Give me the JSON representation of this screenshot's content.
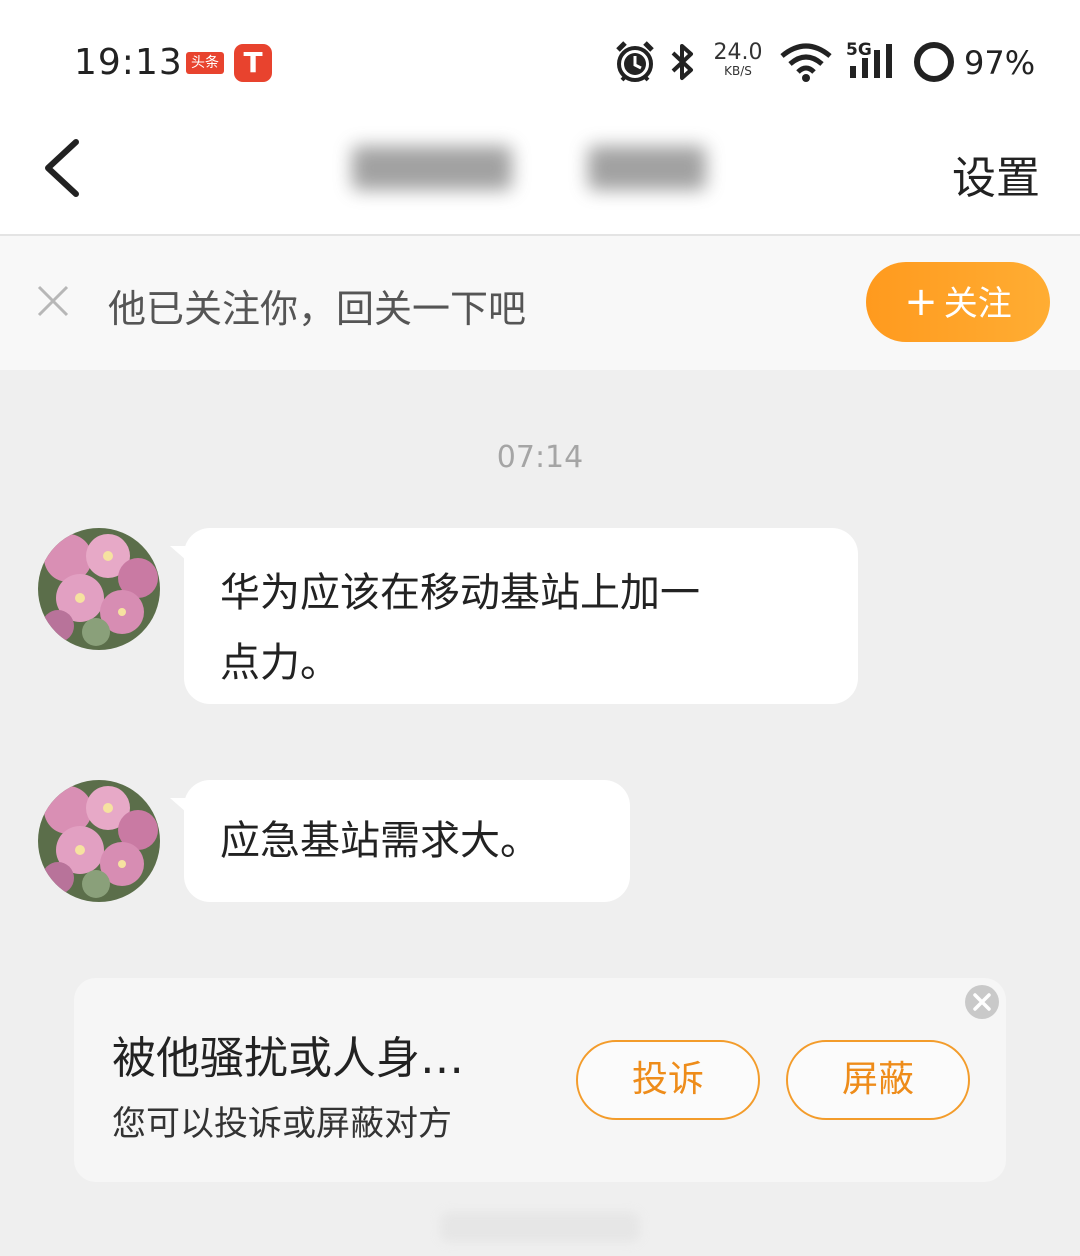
{
  "status_bar": {
    "time": "19:13",
    "app_badge_toutiao": "头条",
    "app_badge_t": "T",
    "net_speed_value": "24.0",
    "net_speed_unit": "KB/S",
    "network_type": "5G",
    "battery_percent": "97%"
  },
  "nav": {
    "settings_label": "设置"
  },
  "follow_banner": {
    "text": "他已关注你，回关一下吧",
    "button_plus": "+",
    "button_label": "关注",
    "accent_color": "#ff9a1e"
  },
  "chat": {
    "timestamp": "07:14",
    "messages": [
      {
        "text_line1": "华为应该在移动基站上加一",
        "text_line2": "点力。"
      },
      {
        "text": "应急基站需求大。"
      }
    ]
  },
  "report_card": {
    "title": "被他骚扰或人身…",
    "subtitle": "您可以投诉或屏蔽对方",
    "complain_label": "投诉",
    "block_label": "屏蔽",
    "button_color": "#ee8c1a"
  }
}
